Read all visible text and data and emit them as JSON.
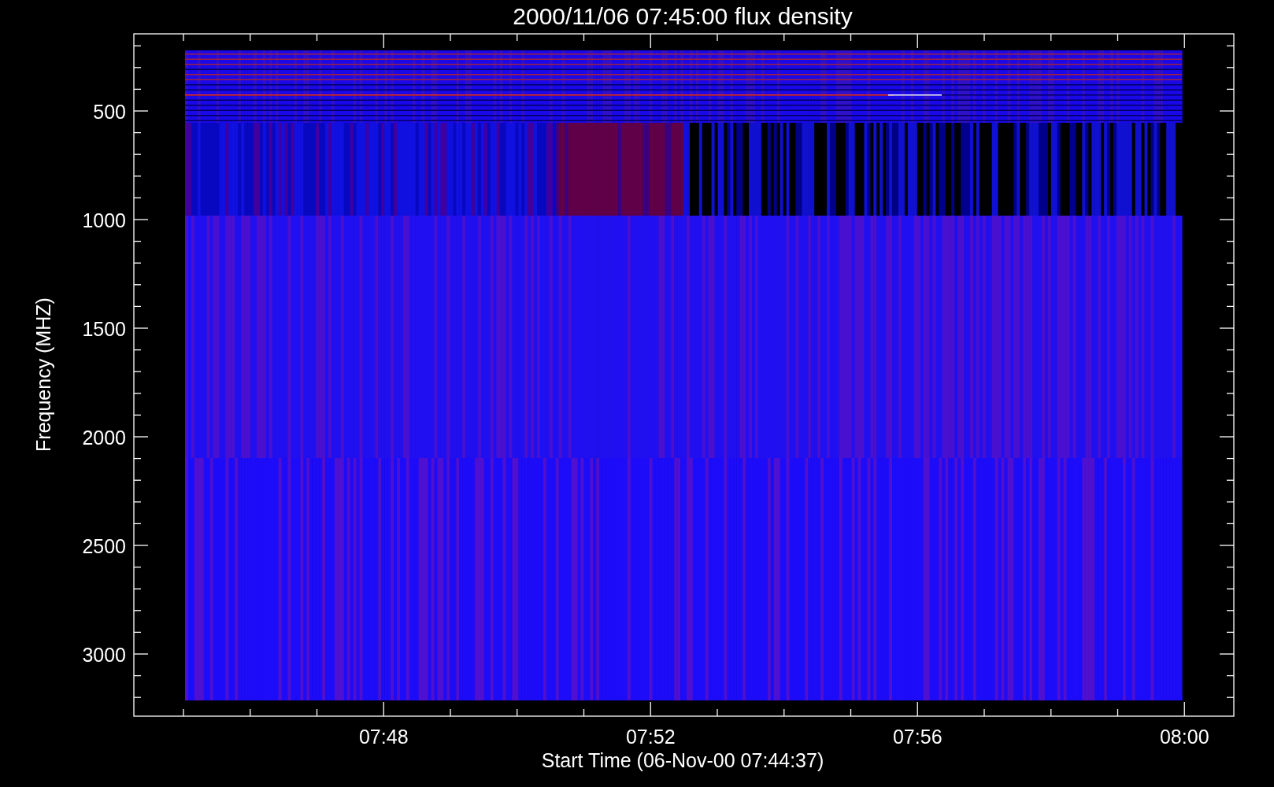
{
  "plot": {
    "title": "2000/11/06 07:45:00 flux density",
    "y_axis": {
      "label": "Frequency (MHZ)",
      "tick_labels": [
        "500",
        "1000",
        "1500",
        "2000",
        "2500",
        "3000"
      ]
    },
    "x_axis": {
      "label": "Start Time (06-Nov-00 07:44:37)",
      "tick_labels": [
        "07:48",
        "07:52",
        "07:56",
        "08:00"
      ]
    }
  }
}
